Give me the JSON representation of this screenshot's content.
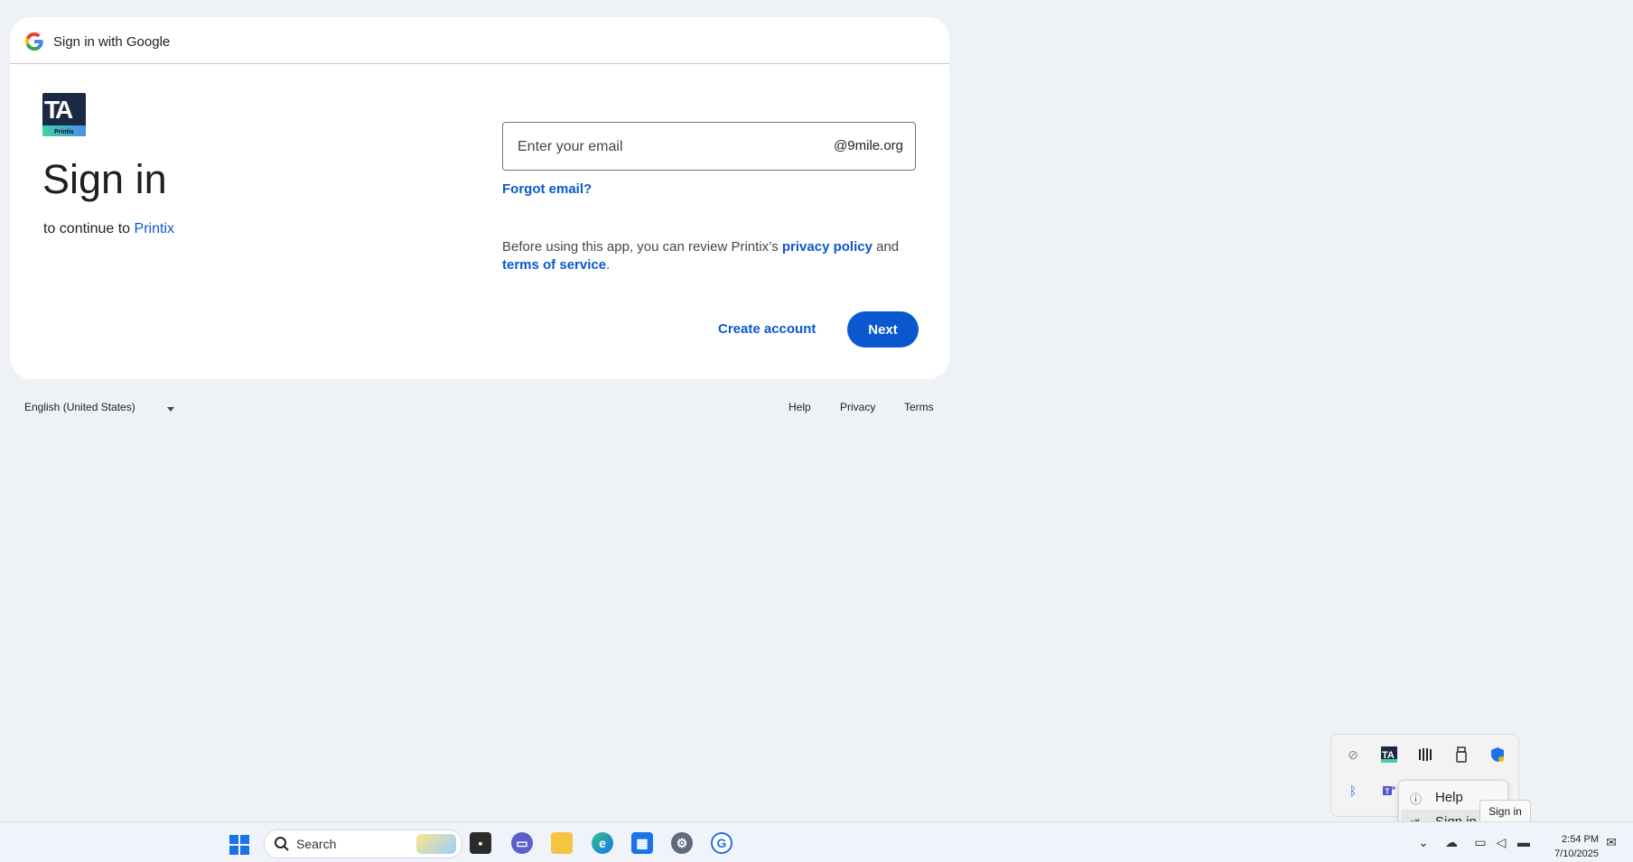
{
  "header": {
    "title": "Sign in with Google"
  },
  "app": {
    "logo_text": "TA",
    "logo_sub": "Printix",
    "name": "Printix"
  },
  "main": {
    "title": "Sign in",
    "continue_prefix": "to continue to ",
    "email_placeholder": "Enter your email",
    "domain_suffix": "@9mile.org",
    "forgot_email": "Forgot email?",
    "privacy_prefix": "Before using this app, you can review Printix’s ",
    "privacy_policy": "privacy policy",
    "and": " and ",
    "terms_of_service": "terms of service",
    "period": ".",
    "create_account": "Create account",
    "next": "Next"
  },
  "footer": {
    "language": "English (United States)",
    "help": "Help",
    "privacy": "Privacy",
    "terms": "Terms"
  },
  "tray": {
    "icons": [
      "link-icon",
      "printix-icon",
      "barcode-icon",
      "usb-icon",
      "shield-icon",
      "bluetooth-icon",
      "teams-icon"
    ],
    "menu": [
      {
        "label": "Help",
        "icon": "help-icon"
      },
      {
        "label": "Sign in",
        "icon": "sign-in-icon"
      }
    ],
    "tooltip": "Sign in"
  },
  "taskbar": {
    "search_label": "Search",
    "time": "2:54 PM",
    "date": "7/10/2025"
  },
  "colors": {
    "accent": "#0b57d0",
    "background": "#eef1f6"
  }
}
